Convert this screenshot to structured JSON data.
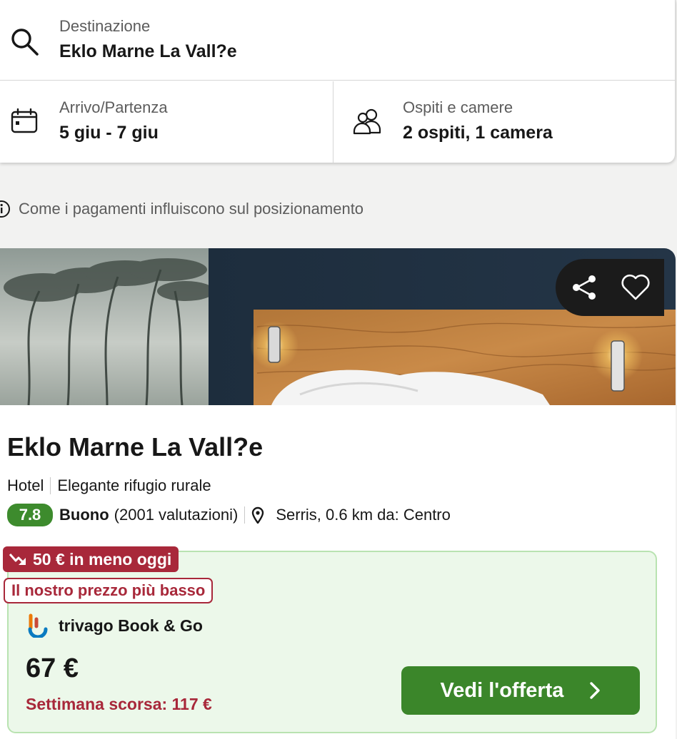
{
  "search": {
    "destination_label": "Destinazione",
    "destination_value": "Eklo Marne La Vall?e",
    "dates_label": "Arrivo/Partenza",
    "dates_value": "5 giu - 7 giu",
    "guests_label": "Ospiti e camere",
    "guests_value": "2 ospiti, 1 camera"
  },
  "info": {
    "text": "Come i pagamenti influiscono sul posizionamento"
  },
  "hotel": {
    "name": "Eklo Marne La Vall?e",
    "type": "Hotel",
    "description": "Elegante rifugio rurale",
    "rating_score": "7.8",
    "rating_word": "Buono",
    "rating_count": "(2001 valutazioni)",
    "location": "Serris, 0.6 km da: Centro"
  },
  "offer": {
    "deal_badge": "50 € in meno oggi",
    "lowest_badge": "Il nostro prezzo più basso",
    "provider": "trivago Book & Go",
    "price": "67 €",
    "last_week": "Settimana scorsa: 117 €",
    "cta_label": "Vedi l'offerta"
  },
  "colors": {
    "rating_green": "#3d8b2d",
    "cta_green": "#3b862a",
    "deal_red": "#a8283a",
    "offer_bg": "#ecf8ea"
  }
}
